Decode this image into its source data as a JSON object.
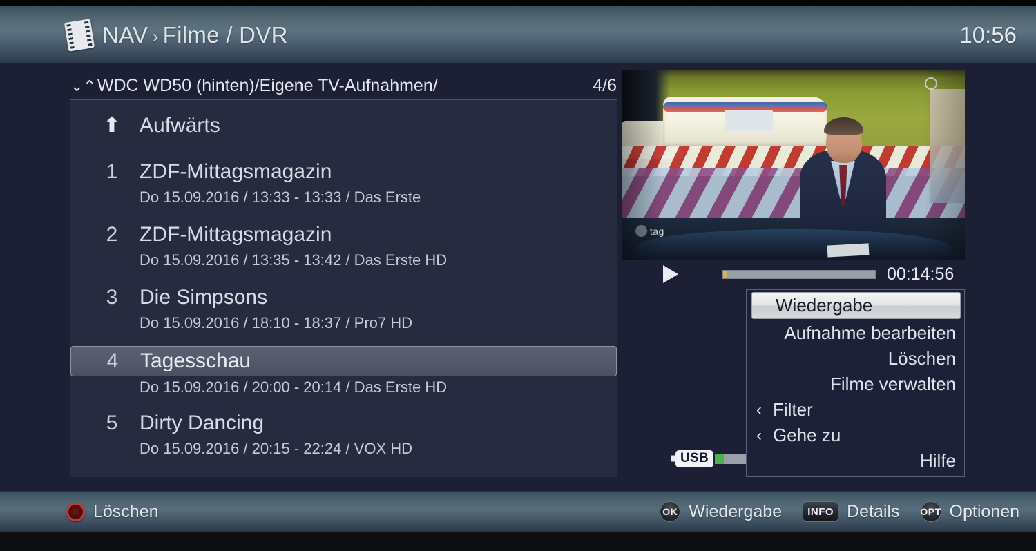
{
  "header": {
    "icon": "film-strip-icon",
    "breadcrumb_root": "NAV",
    "breadcrumb_separator": "›",
    "breadcrumb_current": "Filme / DVR",
    "clock": "10:56"
  },
  "pathbar": {
    "chevron_down": "⌄",
    "chevron_up": "⌃",
    "path": "WDC WD50 (hinten)/Eigene TV-Aufnahmen/",
    "counter": "4/6"
  },
  "list": {
    "updir": {
      "icon": "arrow-up-icon",
      "glyph": "⬆",
      "label": "Aufwärts"
    },
    "items": [
      {
        "num": "1",
        "title": "ZDF-Mittagsmagazin",
        "meta": "Do 15.09.2016 / 13:33 - 13:33 / Das Erste",
        "selected": false
      },
      {
        "num": "2",
        "title": "ZDF-Mittagsmagazin",
        "meta": "Do 15.09.2016 / 13:35 - 13:42 / Das Erste HD",
        "selected": false
      },
      {
        "num": "3",
        "title": "Die Simpsons",
        "meta": "Do 15.09.2016 / 18:10 - 18:37 / Pro7 HD",
        "selected": false
      },
      {
        "num": "4",
        "title": "Tagesschau",
        "meta": "Do 15.09.2016 / 20:00 - 20:14 / Das Erste HD",
        "selected": true
      },
      {
        "num": "5",
        "title": "Dirty Dancing",
        "meta": "Do 15.09.2016 / 20:15 - 22:24 / VOX HD",
        "selected": false
      }
    ]
  },
  "preview": {
    "channel_logo_text": "tag",
    "playback": {
      "play_icon": "play-icon",
      "duration": "00:14:56"
    }
  },
  "storage": {
    "device_badge": "USB"
  },
  "context_menu": {
    "items": [
      {
        "label": "Wiedergabe",
        "highlighted": true,
        "submenu": false
      },
      {
        "label": "Aufnahme bearbeiten",
        "highlighted": false,
        "submenu": false
      },
      {
        "label": "Löschen",
        "highlighted": false,
        "submenu": false
      },
      {
        "label": "Filme verwalten",
        "highlighted": false,
        "submenu": false
      },
      {
        "label": "Filter",
        "highlighted": false,
        "submenu": true
      },
      {
        "label": "Gehe zu",
        "highlighted": false,
        "submenu": true
      },
      {
        "label": "Hilfe",
        "highlighted": false,
        "submenu": false
      }
    ],
    "submenu_arrow": "‹"
  },
  "footer": {
    "left": [
      {
        "key_type": "round-red",
        "key_label": "",
        "label": "Löschen"
      }
    ],
    "right": [
      {
        "key_type": "round",
        "key_label": "OK",
        "label": "Wiedergabe"
      },
      {
        "key_type": "rect",
        "key_label": "INFO",
        "label": "Details"
      },
      {
        "key_type": "round",
        "key_label": "OPT",
        "label": "Optionen"
      }
    ]
  },
  "colors": {
    "background": "#1d2035",
    "panel": "#262b40",
    "chrome_bar": "#576d7b",
    "selection": "#545a6b",
    "accent_yellow": "#d8b24a",
    "accent_green": "#4bb34b",
    "accent_red": "#c23b3b"
  }
}
